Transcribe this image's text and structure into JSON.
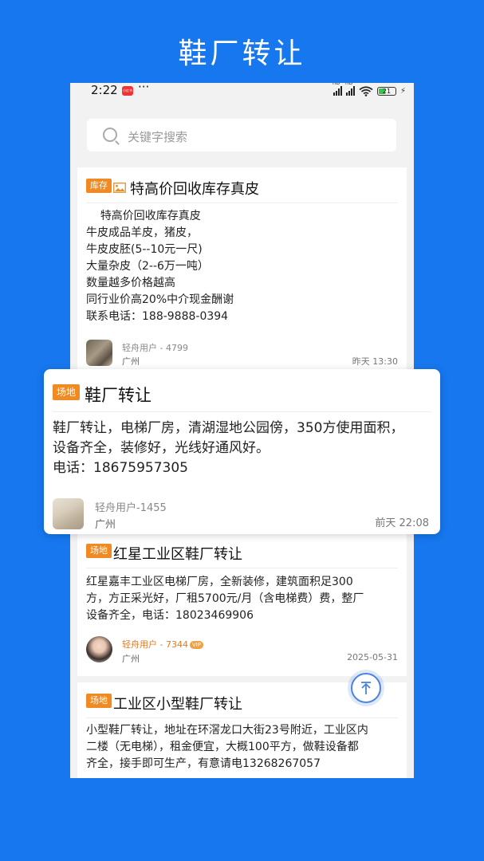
{
  "banner": {
    "title": "鞋厂转让"
  },
  "status_bar": {
    "time": "2:22",
    "badge": "小红书",
    "dots": "···",
    "battery": "21"
  },
  "search": {
    "placeholder": "关键字搜索"
  },
  "listings": [
    {
      "tag": "库存",
      "title": "特高价回收库存真皮",
      "body": "    特高价回收库存真皮\n牛皮成品羊皮，猪皮，\n牛皮皮胚(5--10元一尺)\n大量杂皮（2--6万一吨）\n数量越多价格越高\n同行业价高20%中介现金酬谢\n联系电话：188-9888-0394",
      "user": "轻舟用户 - 4799",
      "city": "广州",
      "time": "昨天 13:30"
    },
    {
      "tag": "场地",
      "title": "鞋厂转让",
      "body": "鞋厂转让，电梯厂房，清湖湿地公园傍，350方使用面积，\n设备齐全，装修好，光线好通风好。\n电话：18675957305",
      "user": "轻舟用户-1455",
      "city": "广州",
      "time": "前天 22:08"
    },
    {
      "tag": "场地",
      "title": "红星工业区鞋厂转让",
      "body": "红星嘉丰工业区电梯厂房，全新装修，建筑面积足300\n方，方正采光好，厂租5700元/月（含电梯费）费，整厂\n设备齐全，电话：18023469906",
      "user": "轻舟用户 - 7344",
      "vip": "VIP",
      "city": "广州",
      "time": "2025-05-31"
    },
    {
      "tag": "场地",
      "title": "工业区小型鞋厂转让",
      "body": "小型鞋厂转让，地址在环滘龙口大街23号附近，工业区内\n二楼（无电梯），租金便宜，大概100平方，做鞋设备都\n齐全，接手即可生产，有意请电13268267057"
    }
  ],
  "colors": {
    "background": "#1677ee",
    "tag": "#f08a22",
    "accent": "#4a82e0"
  },
  "icons": [
    "search-icon",
    "image-icon",
    "arrow-up-icon",
    "signal-icon",
    "wifi-icon",
    "battery-icon"
  ]
}
